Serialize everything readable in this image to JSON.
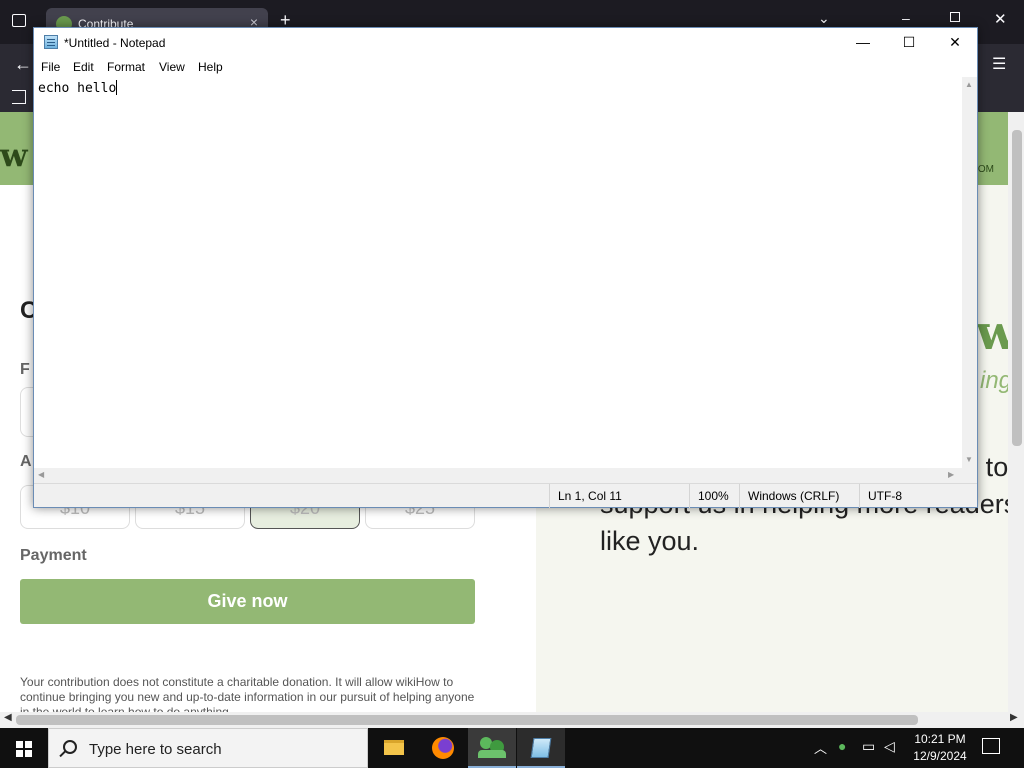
{
  "browser": {
    "tab_title": "Contribute",
    "tab_close": "×",
    "new_tab": "+",
    "site_logo_partial": "w",
    "site_header_right": "OM",
    "page": {
      "heading_partial": "C",
      "label_from_partial": "F",
      "label_amount_partial": "A",
      "amounts": [
        "$10",
        "$15",
        "$20",
        "$25"
      ],
      "selected_amount_index": 2,
      "payment_label": "Payment",
      "give_button": "Give now",
      "disclaimer": "Your contribution does not constitute a charitable donation. It will allow wikiHow to continue bringing you new and up-to-date information in our pursuit of helping anyone in the world to learn how to do anything.",
      "right_logo_partial": "w",
      "right_sub_partial": "ing",
      "right_text": "as consider a small contribution to support us in helping more readers like you."
    }
  },
  "notepad": {
    "title": "*Untitled - Notepad",
    "minimize": "—",
    "maximize": "☐",
    "close": "✕",
    "menu": [
      "File",
      "Edit",
      "Format",
      "View",
      "Help"
    ],
    "content": "echo hello",
    "status": {
      "position": "Ln 1, Col 11",
      "zoom": "100%",
      "line_ending": "Windows (CRLF)",
      "encoding": "UTF-8"
    }
  },
  "taskbar": {
    "search_placeholder": "Type here to search",
    "apps": [
      "file-explorer",
      "firefox",
      "people-app",
      "notepad"
    ],
    "active_app_index": 2,
    "clock_time": "10:21 PM",
    "clock_date": "12/9/2024"
  },
  "colors": {
    "wikihow_green": "#93b874",
    "taskbar": "#101010"
  }
}
